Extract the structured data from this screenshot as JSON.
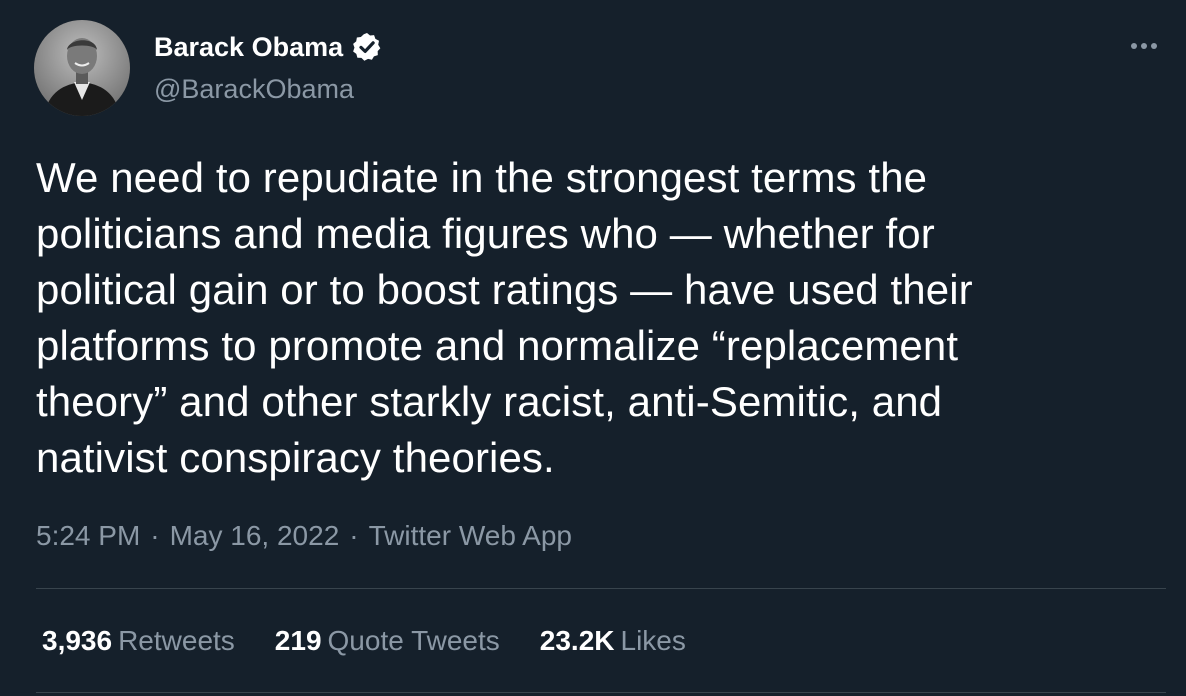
{
  "author": {
    "name": "Barack Obama",
    "handle": "@BarackObama",
    "verified_icon": "verified-badge-icon",
    "avatar_icon": "profile-photo"
  },
  "tweet": {
    "text": "We need to repudiate in the strongest terms the\npoliticians and media figures who — whether for\npolitical gain or to boost ratings — have used their\nplatforms to promote and normalize “replacement\ntheory” and other starkly racist, anti-Semitic, and\nnativist conspiracy theories."
  },
  "meta": {
    "time": "5:24 PM",
    "separator": "·",
    "date": "May 16, 2022",
    "source": "Twitter Web App"
  },
  "stats": {
    "retweets": {
      "value": "3,936",
      "label": "Retweets"
    },
    "quotes": {
      "value": "219",
      "label": "Quote Tweets"
    },
    "likes": {
      "value": "23.2K",
      "label": "Likes"
    }
  },
  "colors": {
    "background": "#15202b",
    "text_primary": "#ffffff",
    "text_secondary": "#8b98a5",
    "divider": "#38444d"
  }
}
